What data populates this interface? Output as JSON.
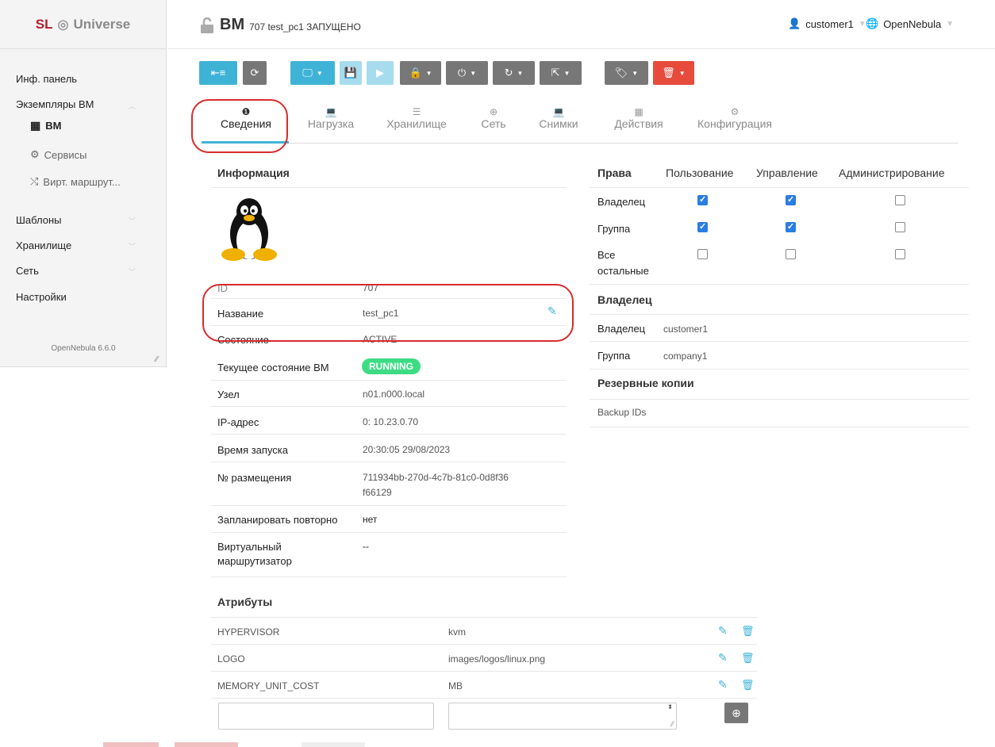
{
  "sidebar": {
    "logo_left": "SL",
    "logo_right": "Universe",
    "items": [
      {
        "label": "Инф. панель"
      },
      {
        "label": "Экземпляры ВМ"
      },
      {
        "label": "ВМ"
      },
      {
        "label": "Сервисы"
      },
      {
        "label": "Вирт. маршрут..."
      },
      {
        "label": "Шаблоны"
      },
      {
        "label": "Хранилище"
      },
      {
        "label": "Сеть"
      },
      {
        "label": "Настройки"
      }
    ],
    "version": "OpenNebula 6.6.0"
  },
  "header": {
    "title_big": "ВМ",
    "title_small": "707 test_pc1 ЗАПУЩЕНО",
    "user": "customer1",
    "zone": "OpenNebula"
  },
  "tabs": [
    {
      "label": "Сведения",
      "icon": "info-icon"
    },
    {
      "label": "Нагрузка",
      "icon": "laptop-icon"
    },
    {
      "label": "Хранилище",
      "icon": "database-icon"
    },
    {
      "label": "Сеть",
      "icon": "globe-icon"
    },
    {
      "label": "Снимки",
      "icon": "laptop-icon"
    },
    {
      "label": "Действия",
      "icon": "calendar-icon"
    },
    {
      "label": "Конфигурация",
      "icon": "gear-icon"
    }
  ],
  "info": {
    "title": "Информация",
    "rows": [
      {
        "label": "ID",
        "value": "707"
      },
      {
        "label": "Название",
        "value": "test_pc1"
      },
      {
        "label": "Состояние",
        "value": "ACTIVE"
      },
      {
        "label": "Текущее состояние ВМ",
        "value": "RUNNING"
      },
      {
        "label": "Узел",
        "value": "n01.n000.local"
      },
      {
        "label": "IP-адрес",
        "value": "0: 10.23.0.70"
      },
      {
        "label": "Время запуска",
        "value": "20:30:05 29/08/2023"
      },
      {
        "label": "№ размещения",
        "value": "711934bb-270d-4c7b-81c0-0d8f36",
        "value2": "f66129"
      },
      {
        "label": "Запланировать повторно",
        "value": "нет"
      },
      {
        "label": "Виртуальный",
        "label2": "маршрутизатор",
        "value": "--"
      }
    ]
  },
  "perms": {
    "headers": [
      "Права",
      "Пользование",
      "Управление",
      "Администрирование"
    ],
    "rows": [
      {
        "label": "Владелец",
        "use": true,
        "manage": true,
        "admin": false
      },
      {
        "label": "Группа",
        "use": true,
        "manage": true,
        "admin": false
      },
      {
        "label": "Все",
        "label2": "остальные",
        "use": false,
        "manage": false,
        "admin": false
      }
    ]
  },
  "owner": {
    "title": "Владелец",
    "owner_label": "Владелец",
    "owner_value": "customer1",
    "group_label": "Группа",
    "group_value": "company1"
  },
  "backup": {
    "title": "Резервные копии",
    "ids_label": "Backup IDs"
  },
  "attributes": {
    "title": "Атрибуты",
    "rows": [
      {
        "key": "HYPERVISOR",
        "value": "kvm"
      },
      {
        "key": "LOGO",
        "value": "images/logos/linux.png"
      },
      {
        "key": "MEMORY_UNIT_COST",
        "value": "MB"
      }
    ]
  },
  "colors": {
    "accent": "#3fb3d6",
    "running": "#3ddc84",
    "danger": "#e64b3c",
    "annotation": "#d92b2b"
  }
}
